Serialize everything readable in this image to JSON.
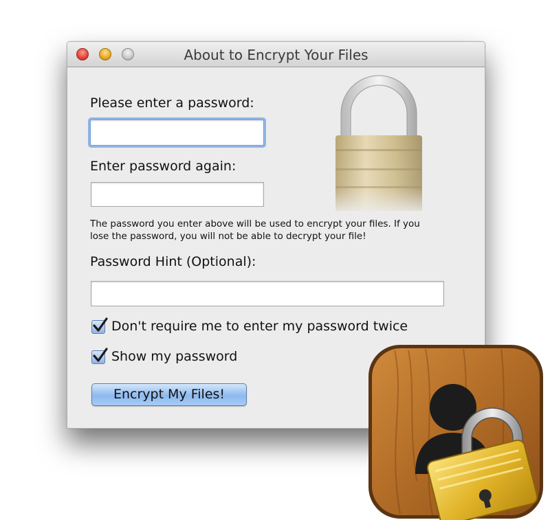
{
  "window": {
    "title": "About to Encrypt Your Files"
  },
  "form": {
    "password_label": "Please enter a password:",
    "password_value": "",
    "confirm_label": "Enter password again:",
    "confirm_value": "",
    "note_line1": "The password you enter above will be used to encrypt your files.  If you",
    "note_line2": "lose the password, you will not be able to decrypt your file!",
    "hint_label": "Password Hint (Optional):",
    "hint_value": "",
    "checkboxes": [
      {
        "label": "Don't require me to enter my password twice",
        "checked": true
      },
      {
        "label": "Show my password",
        "checked": true
      }
    ],
    "submit_label": "Encrypt My Files!"
  },
  "icons": [
    "close-button",
    "minimize-button",
    "zoom-button",
    "padlock-icon",
    "checkmark-icon",
    "app-icon"
  ],
  "colors": {
    "focus_ring": "#8fb4e6",
    "button_blue": "#8db9ef",
    "padlock_gold": "#c9b27a",
    "app_wood": "#b06a26"
  }
}
